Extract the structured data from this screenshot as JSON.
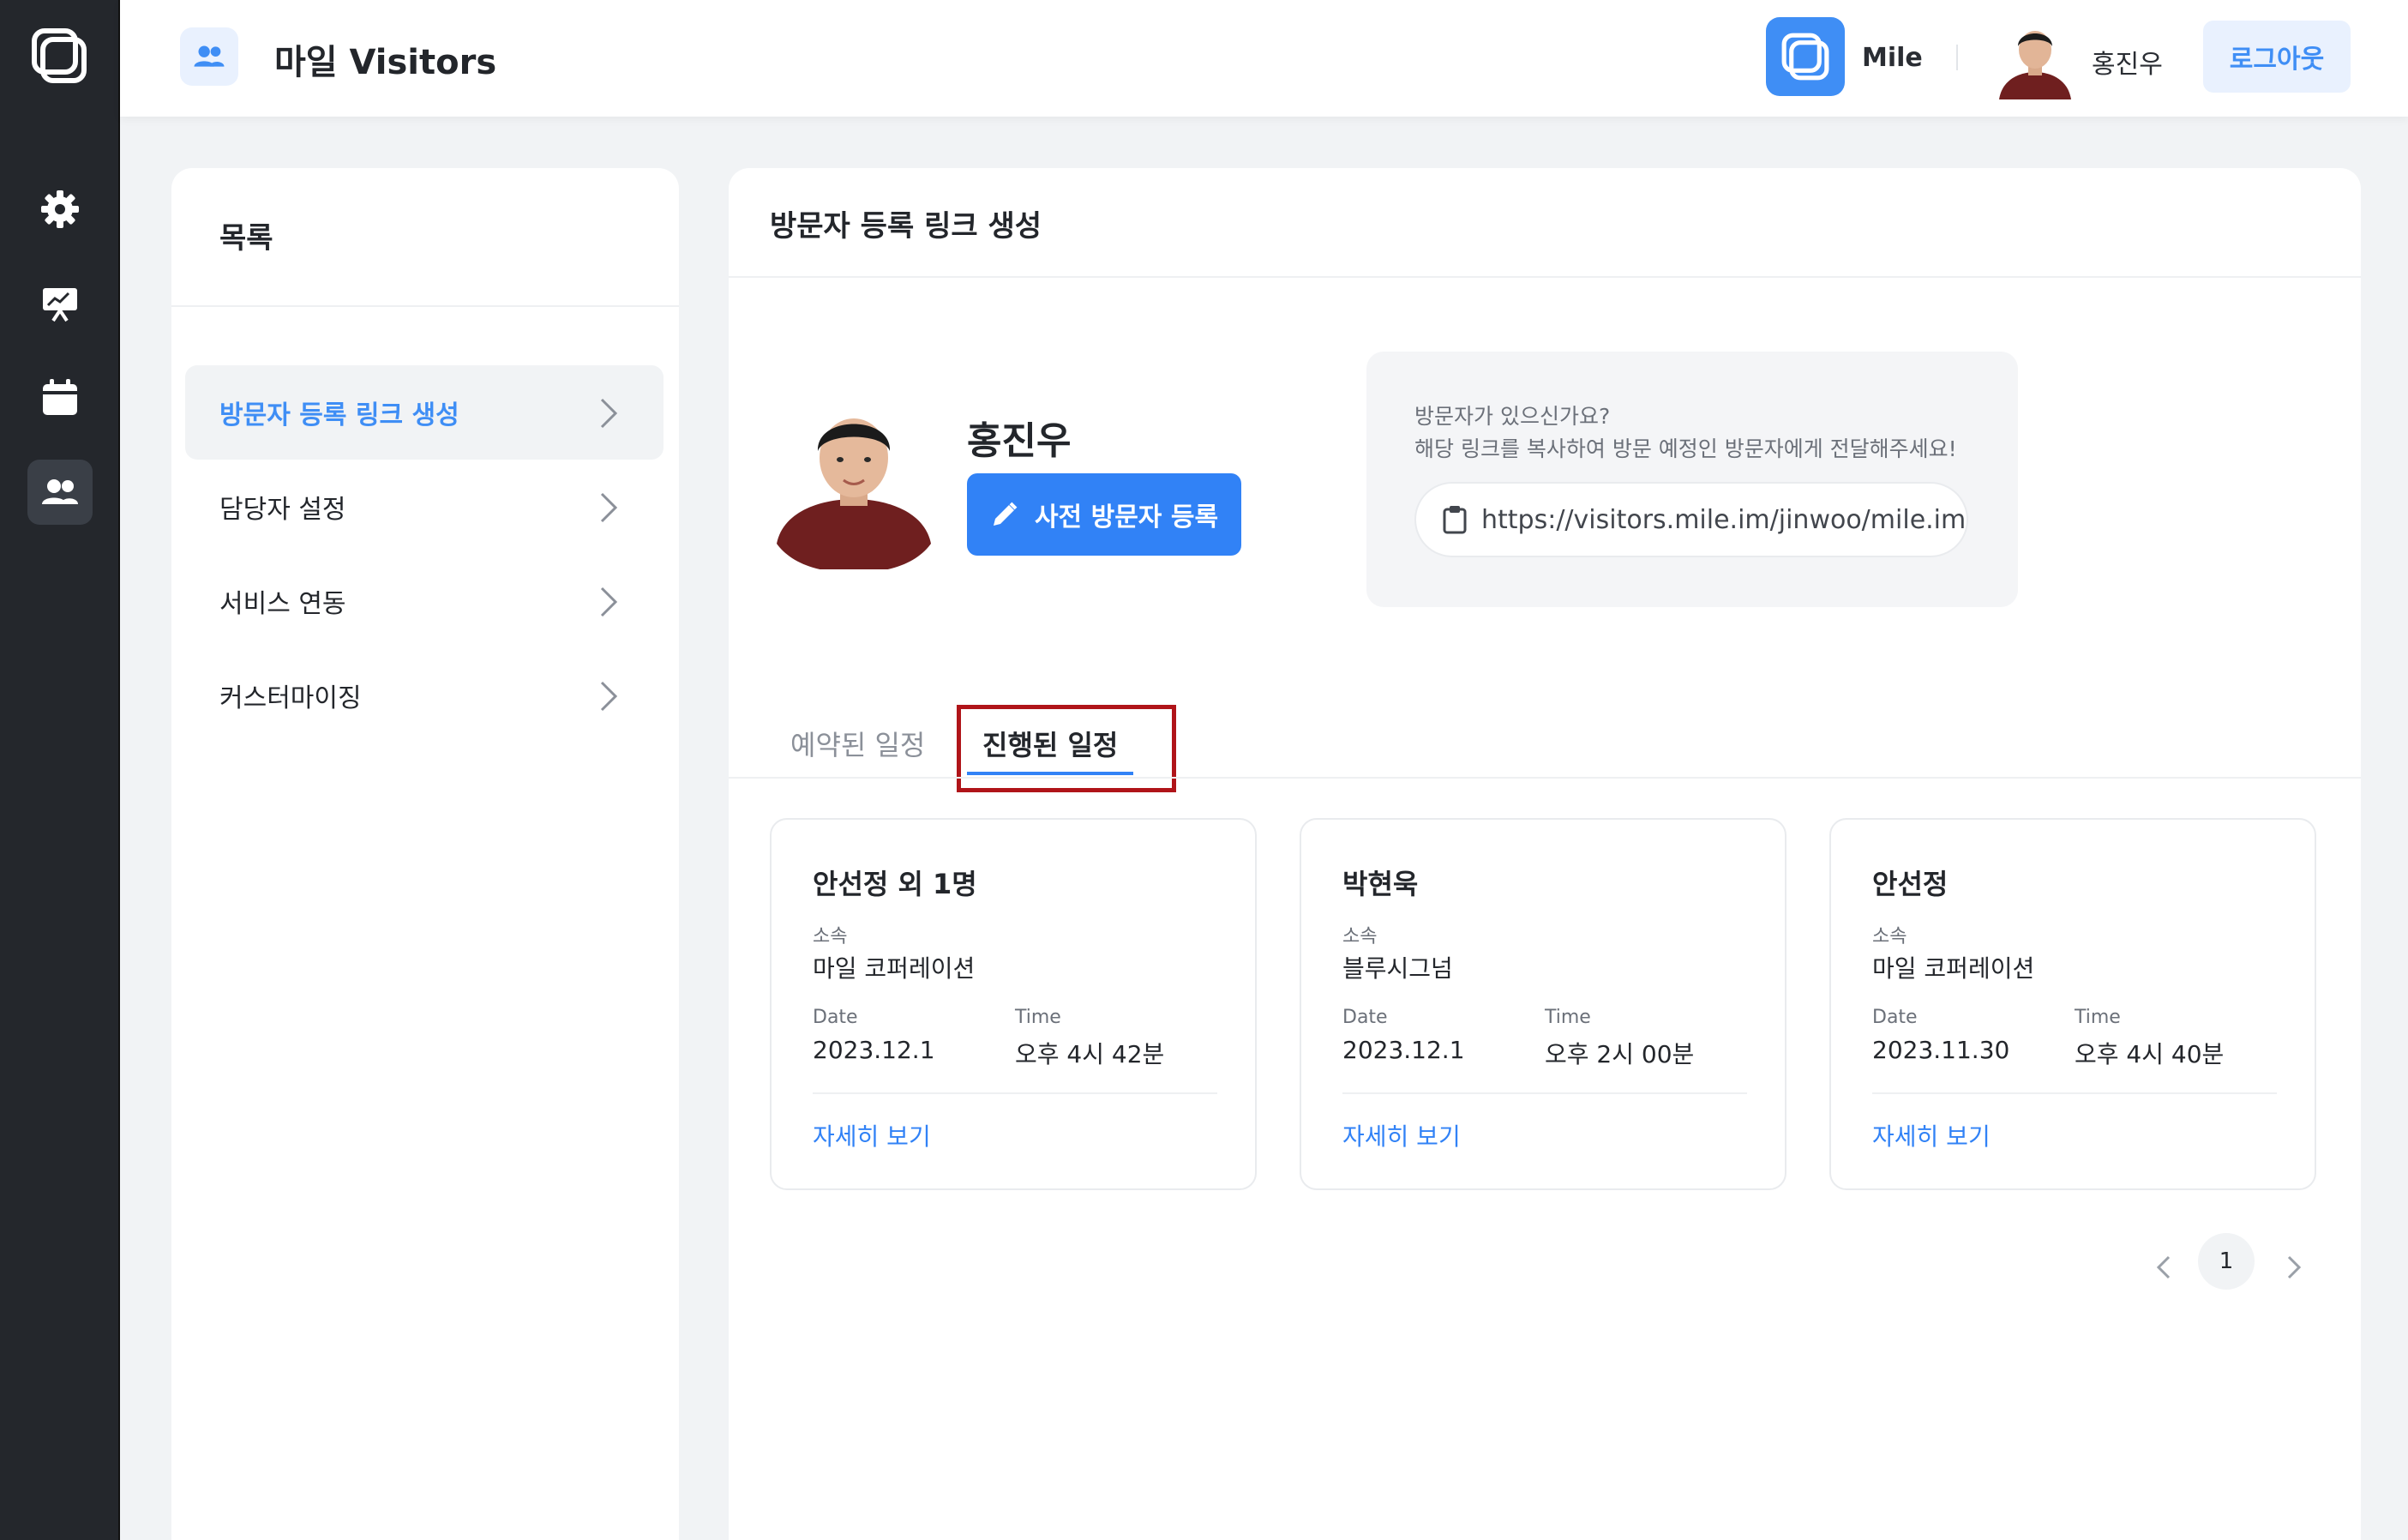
{
  "header": {
    "app_title": "마일 Visitors",
    "brand_name": "Mile",
    "user_name": "홍진우",
    "logout_label": "로그아웃"
  },
  "rail": {
    "items": [
      {
        "icon": "gear-icon"
      },
      {
        "icon": "presentation-icon"
      },
      {
        "icon": "calendar-icon"
      },
      {
        "icon": "users-icon",
        "active": true
      }
    ]
  },
  "sidebar": {
    "title": "목록",
    "items": [
      {
        "label": "방문자 등록 링크 생성",
        "active": true
      },
      {
        "label": "담당자 설정"
      },
      {
        "label": "서비스 연동"
      },
      {
        "label": "커스터마이징"
      }
    ]
  },
  "main": {
    "page_title": "방문자 등록 링크 생성",
    "profile_name": "홍진우",
    "preregister_label": "사전 방문자 등록",
    "link_box": {
      "line1": "방문자가 있으신가요?",
      "line2": "해당 링크를 복사하여 방문 예정인 방문자에게 전달해주세요!",
      "url": "https://visitors.mile.im/jinwoo/mile.im"
    },
    "tabs": [
      {
        "label": "예약된 일정",
        "active": false
      },
      {
        "label": "진행된 일정",
        "active": true
      }
    ],
    "cards": [
      {
        "name": "안선정 외 1명",
        "affiliation_label": "소속",
        "affiliation": "마일 코퍼레이션",
        "date_label": "Date",
        "date": "2023.12.1",
        "time_label": "Time",
        "time": "오후 4시 42분",
        "link": "자세히 보기"
      },
      {
        "name": "박현욱",
        "affiliation_label": "소속",
        "affiliation": "블루시그넘",
        "date_label": "Date",
        "date": "2023.12.1",
        "time_label": "Time",
        "time": "오후 2시 00분",
        "link": "자세히 보기"
      },
      {
        "name": "안선정",
        "affiliation_label": "소속",
        "affiliation": "마일 코퍼레이션",
        "date_label": "Date",
        "date": "2023.11.30",
        "time_label": "Time",
        "time": "오후 4시 40분",
        "link": "자세히 보기"
      }
    ],
    "pagination": {
      "current": "1"
    }
  },
  "colors": {
    "accent": "#3182f6",
    "rail_bg": "#24272c",
    "highlight_border": "#b01419"
  }
}
